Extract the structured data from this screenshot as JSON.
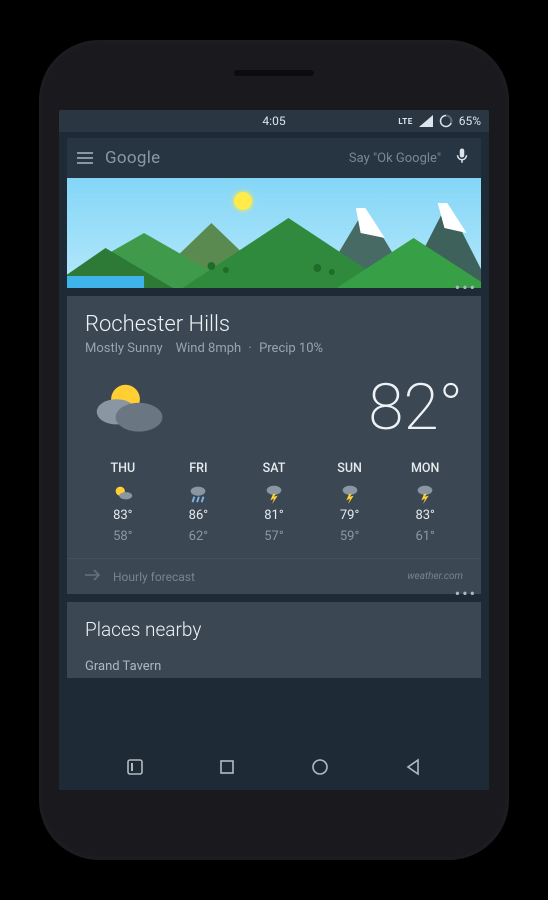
{
  "status": {
    "time": "4:05",
    "network_label": "LTE",
    "battery_percent": "65%"
  },
  "search": {
    "logo": "Google",
    "hint": "Say \"Ok Google\""
  },
  "weather": {
    "location": "Rochester Hills",
    "condition": "Mostly Sunny",
    "wind": "Wind 8mph",
    "precip": "Precip 10%",
    "temp": "82°",
    "forecast": [
      {
        "day": "THU",
        "hi": "83°",
        "lo": "58°"
      },
      {
        "day": "FRI",
        "hi": "86°",
        "lo": "62°"
      },
      {
        "day": "SAT",
        "hi": "81°",
        "lo": "57°"
      },
      {
        "day": "SUN",
        "hi": "79°",
        "lo": "59°"
      },
      {
        "day": "MON",
        "hi": "83°",
        "lo": "61°"
      }
    ],
    "hourly_label": "Hourly forecast",
    "attribution": "weather.com"
  },
  "places": {
    "title": "Places nearby",
    "items": [
      "Grand Tavern"
    ]
  }
}
